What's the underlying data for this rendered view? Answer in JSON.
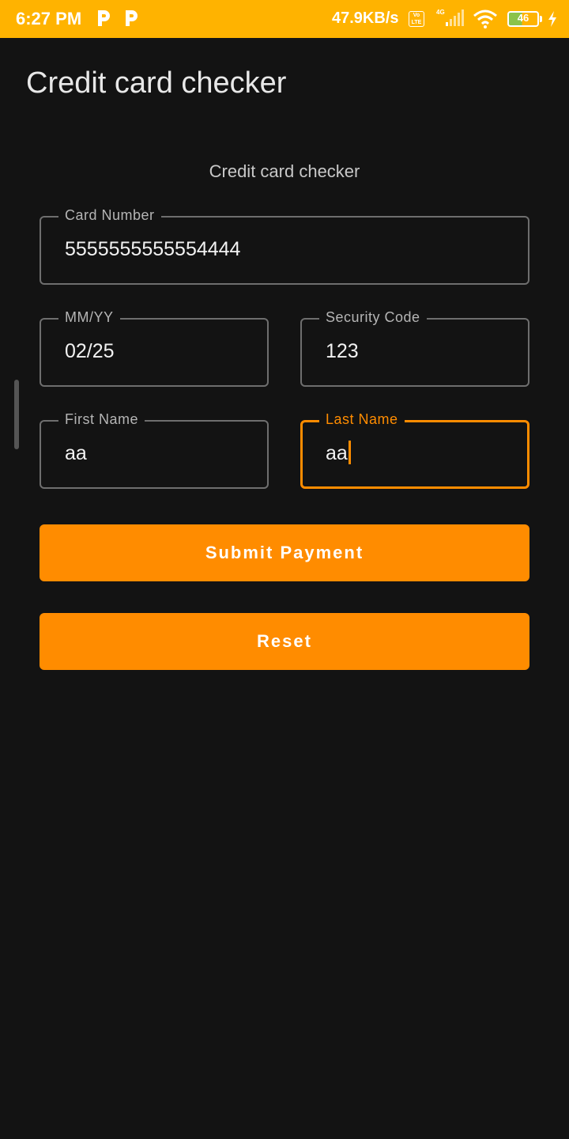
{
  "status_bar": {
    "time": "6:27 PM",
    "network_speed": "47.9KB/s",
    "volte_label": "Vo LTE",
    "network_type": "4G",
    "battery_level": "46",
    "bar_color": "#FFB300"
  },
  "app_bar": {
    "title": "Credit card checker"
  },
  "form": {
    "heading": "Credit card checker",
    "card_number": {
      "label": "Card Number",
      "value": "5555555555554444"
    },
    "expiry": {
      "label": "MM/YY",
      "value": "02/25"
    },
    "security_code": {
      "label": "Security Code",
      "value": "123"
    },
    "first_name": {
      "label": "First Name",
      "value": "aa"
    },
    "last_name": {
      "label": "Last Name",
      "value": "aa"
    },
    "submit_label": "Submit Payment",
    "reset_label": "Reset",
    "accent_color": "#FF8C00"
  }
}
